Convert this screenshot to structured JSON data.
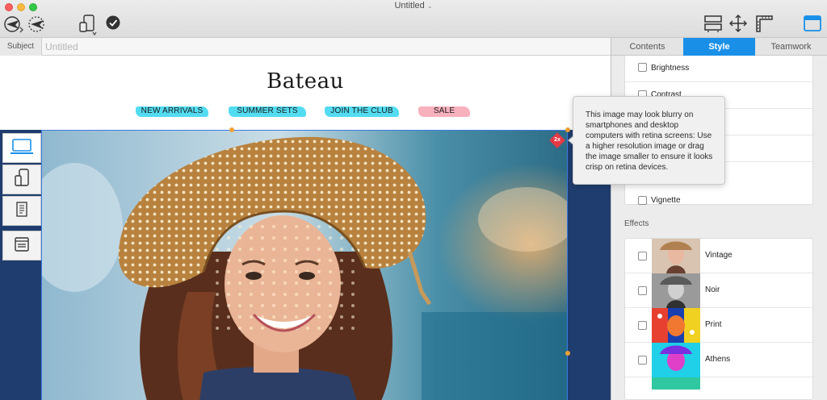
{
  "window": {
    "title": "Untitled"
  },
  "subject": {
    "label": "Subject",
    "placeholder": "Untitled"
  },
  "email": {
    "brand": "Bateau",
    "nav": [
      {
        "label": "NEW ARRIVALS",
        "brush_color": "#35d6ef"
      },
      {
        "label": "SUMMER SETS",
        "brush_color": "#35d6ef"
      },
      {
        "label": "JOIN THE CLUB",
        "brush_color": "#35d6ef"
      },
      {
        "label": "SALE",
        "brush_color": "#f6a9b6"
      }
    ],
    "background_color": "#1f3d6e",
    "retina_badge": "2x"
  },
  "tooltip": {
    "text": "This image may look blurry on smartphones and desktop computers with retina screens: Use a higher resolution image or drag the image smaller to ensure it looks crisp on retina devices."
  },
  "panel": {
    "tabs": [
      "Contents",
      "Style",
      "Teamwork"
    ],
    "active_tab": "Style",
    "adjustments": [
      "Brightness",
      "Contrast",
      "",
      "",
      "",
      "Vignette"
    ],
    "effects_title": "Effects",
    "effects": [
      "Vintage",
      "Noir",
      "Print",
      "Athens"
    ]
  },
  "colors": {
    "accent": "#1a8fe8",
    "selection": "#3d7ae0"
  }
}
